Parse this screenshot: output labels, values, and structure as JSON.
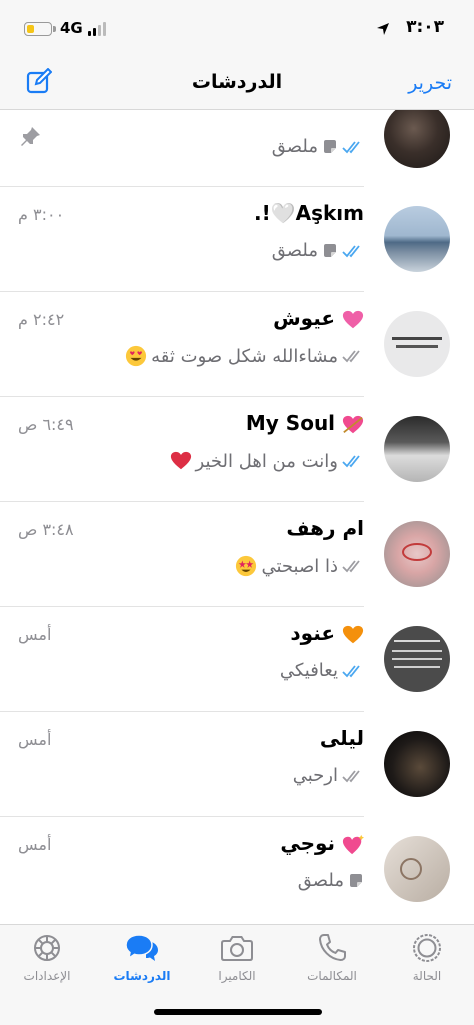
{
  "status_bar": {
    "time": "٣:٠٣",
    "network": "4G",
    "battery_level": 0.35,
    "battery_color": "#f5c518"
  },
  "nav": {
    "title": "الدردشات",
    "edit_label": "تحرير",
    "compose_icon": "compose-icon"
  },
  "chats": [
    {
      "name": "",
      "time": "",
      "preview": "ملصق",
      "ticks": "read",
      "preview_icon": "sticker-icon",
      "pinned": true
    },
    {
      "name": "Aşkım🤍!.",
      "time": "٣:٠٠ م",
      "preview": "ملصق",
      "ticks": "read",
      "preview_icon": "sticker-icon"
    },
    {
      "name": "عيوش",
      "name_emoji": "pink-heart",
      "time": "٢:٤٢ م",
      "preview": "مشاءالله شكل صوت ثقه",
      "preview_emoji": "heart-eyes",
      "ticks": "delivered"
    },
    {
      "name": "My Soul",
      "name_emoji": "heart-arrow",
      "time": "٦:٤٩ ص",
      "preview": "وانت من اهل الخير",
      "preview_emoji": "red-heart",
      "ticks": "read"
    },
    {
      "name": "ام رهف",
      "time": "٣:٤٨ ص",
      "preview": "ذا اصبحتي",
      "preview_emoji": "star-struck",
      "ticks": "delivered"
    },
    {
      "name": "عنود",
      "name_emoji": "orange-heart",
      "time": "أمس",
      "preview": "يعافيكي",
      "ticks": "read"
    },
    {
      "name": "ليلى",
      "time": "أمس",
      "preview": "ارحبي",
      "ticks": "delivered"
    },
    {
      "name": "نوجي",
      "name_emoji": "sparkle-heart",
      "time": "أمس",
      "preview": "ملصق",
      "preview_icon": "sticker-icon",
      "ticks": "none"
    }
  ],
  "tabs": [
    {
      "label": "الإعدادات",
      "icon": "settings-icon"
    },
    {
      "label": "الدردشات",
      "icon": "chats-icon",
      "active": true
    },
    {
      "label": "الكاميرا",
      "icon": "camera-icon"
    },
    {
      "label": "المكالمات",
      "icon": "calls-icon"
    },
    {
      "label": "الحالة",
      "icon": "status-icon"
    }
  ],
  "colors": {
    "accent": "#1a7cf5",
    "read_ticks": "#4aa7f0",
    "secondary_text": "#8e8e93"
  }
}
